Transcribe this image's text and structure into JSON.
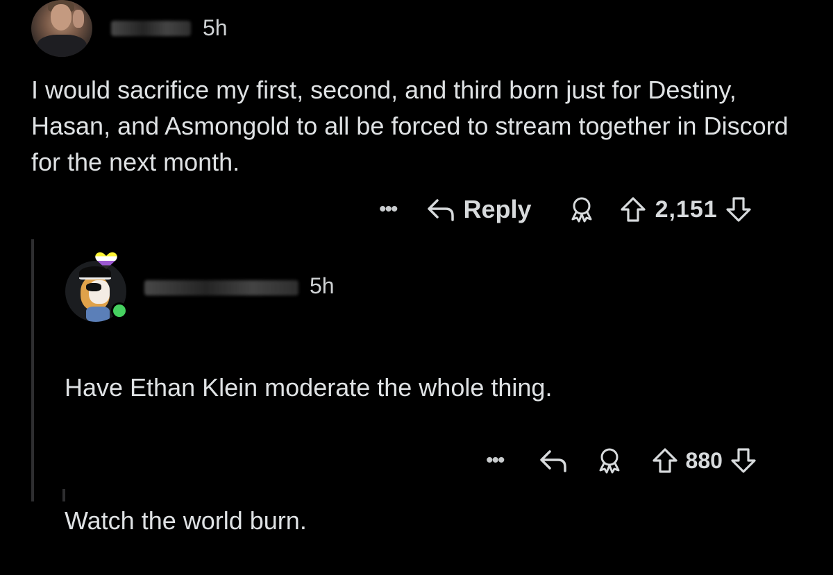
{
  "comments": [
    {
      "time": "5h",
      "text": "I would sacrifice my first, second, and third born just for Destiny, Hasan, and Asmongold to all be forced to stream together in Discord for the next month.",
      "actions": {
        "more": "•••",
        "reply_label": "Reply",
        "votes": "2,151"
      }
    },
    {
      "time": "5h",
      "paragraphs": [
        "Have Ethan Klein moderate the whole thing.",
        "Watch the world burn."
      ],
      "actions": {
        "more": "•••",
        "votes": "880"
      }
    }
  ],
  "icons": {
    "reply": "reply-arrow-icon",
    "award": "award-icon",
    "upvote": "upvote-arrow-icon",
    "downvote": "downvote-arrow-icon",
    "flair": "heart-flair-icon"
  },
  "colors": {
    "background": "#000000",
    "text": "#dfe2e4",
    "online": "#46d160",
    "flair_stripes": [
      "#fcf434",
      "#ffffff",
      "#9c59d1",
      "#2c2c2c"
    ]
  }
}
